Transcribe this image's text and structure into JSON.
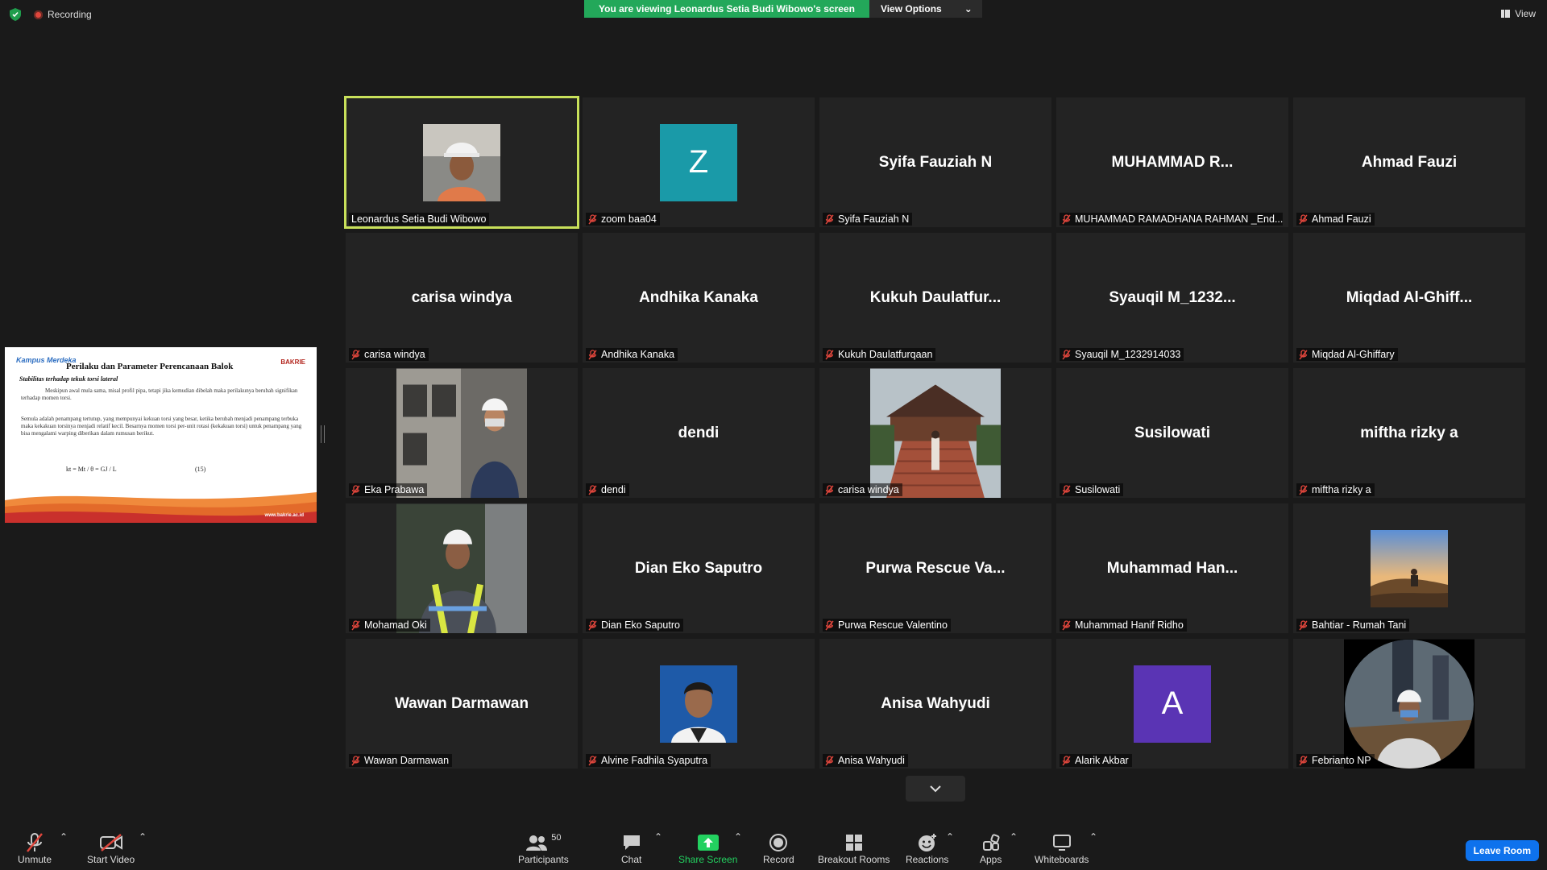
{
  "top": {
    "recording_label": "Recording",
    "banner_text": "You are viewing Leonardus Setia Budi Wibowo's screen",
    "view_options_label": "View Options",
    "view_label": "View"
  },
  "shared_slide": {
    "logo_left": "Kampus Merdeka",
    "logo_right": "BAKRIE",
    "title": "Perilaku dan Parameter Perencanaan Balok",
    "subtitle": "Stabilitas terhadap tekuk torsi lateral",
    "para1": "Meskipun awal mula sama, misal profil pipa, tetapi jika kemudian dibelah maka perilakunya berubah signifikan terhadap momen torsi.",
    "para2": "Semula adalah penampang tertutup, yang mempunyai kekuan torsi yang besar, ketika berubah menjadi penampang terbuka maka kekakuan torsinya menjadi relatif kecil. Besarnya momen torsi per-unit rotasi (kekakuan torsi) untuk penampang yang bisa mengalami warping diberikan dalam rumusan berikut.",
    "equation": "kt = Mt / θ = GJ / L",
    "equation_number": "(15)",
    "url": "www.bakrie.ac.id"
  },
  "tiles": [
    {
      "display": "video",
      "label": "Leonardus Setia Budi Wibowo",
      "muted": false,
      "active": true,
      "photo": "hardhat-man-orange"
    },
    {
      "display": "letter",
      "letter": "Z",
      "color": "#1a9aa8",
      "label": "zoom baa04",
      "muted": true
    },
    {
      "display": "name",
      "big": "Syifa Fauziah N",
      "label": "Syifa Fauziah N",
      "muted": true
    },
    {
      "display": "name",
      "big": "MUHAMMAD  R...",
      "label": "MUHAMMAD RAMADHANA RAHMAN _End...",
      "muted": true
    },
    {
      "display": "name",
      "big": "Ahmad Fauzi",
      "label": "Ahmad Fauzi",
      "muted": true
    },
    {
      "display": "name",
      "big": "carisa windya",
      "label": "carisa windya",
      "muted": true
    },
    {
      "display": "name",
      "big": "Andhika Kanaka",
      "label": "Andhika Kanaka",
      "muted": true
    },
    {
      "display": "name",
      "big": "Kukuh  Daulatfur...",
      "label": "Kukuh Daulatfurqaan",
      "muted": true
    },
    {
      "display": "name",
      "big": "Syauqil  M_1232...",
      "label": "Syauqil M_1232914033",
      "muted": true
    },
    {
      "display": "name",
      "big": "Miqdad  Al-Ghiff...",
      "label": "Miqdad Al-Ghiffary",
      "muted": true
    },
    {
      "display": "video",
      "label": "Eka Prabawa",
      "muted": true,
      "photo": "worker-building"
    },
    {
      "display": "name",
      "big": "dendi",
      "label": "dendi",
      "muted": true
    },
    {
      "display": "video",
      "label": "carisa windya",
      "muted": true,
      "photo": "pavilion-stairs"
    },
    {
      "display": "name",
      "big": "Susilowati",
      "label": "Susilowati",
      "muted": true
    },
    {
      "display": "name",
      "big": "miftha rizky a",
      "label": "miftha rizky a",
      "muted": true
    },
    {
      "display": "video",
      "label": "Mohamad Oki",
      "muted": true,
      "photo": "worker-vest"
    },
    {
      "display": "name",
      "big": "Dian Eko Saputro",
      "label": "Dian Eko Saputro",
      "muted": true
    },
    {
      "display": "name",
      "big": "Purwa  Rescue  Va...",
      "label": "Purwa Rescue Valentino",
      "muted": true
    },
    {
      "display": "name",
      "big": "Muhammad  Han...",
      "label": "Muhammad Hanif Ridho",
      "muted": true
    },
    {
      "display": "video",
      "label": "Bahtiar - Rumah Tani",
      "muted": true,
      "photo": "sunset-hill"
    },
    {
      "display": "name",
      "big": "Wawan Darmawan",
      "label": "Wawan Darmawan",
      "muted": true
    },
    {
      "display": "video",
      "label": "Alvine Fadhila Syaputra",
      "muted": true,
      "photo": "portrait-blue"
    },
    {
      "display": "name",
      "big": "Anisa Wahyudi",
      "label": "Anisa Wahyudi",
      "muted": true
    },
    {
      "display": "letter",
      "letter": "A",
      "color": "#5a34b4",
      "label": "Alarik Akbar",
      "muted": true
    },
    {
      "display": "video",
      "label": "Febrianto NP",
      "muted": true,
      "photo": "round-construction"
    }
  ],
  "toolbar": {
    "unmute": "Unmute",
    "start_video": "Start Video",
    "participants": "Participants",
    "participants_count": "50",
    "chat": "Chat",
    "share_screen": "Share Screen",
    "record": "Record",
    "breakout_rooms": "Breakout Rooms",
    "reactions": "Reactions",
    "apps": "Apps",
    "whiteboards": "Whiteboards",
    "leave_room": "Leave Room"
  },
  "colors": {
    "background": "#1a1a1a",
    "tile": "#232323",
    "active_outline": "#c8e05a",
    "banner_green": "#23a85a",
    "share_green": "#23d160",
    "leave_blue": "#0e72ed",
    "mic_off_red": "#e0463c"
  }
}
